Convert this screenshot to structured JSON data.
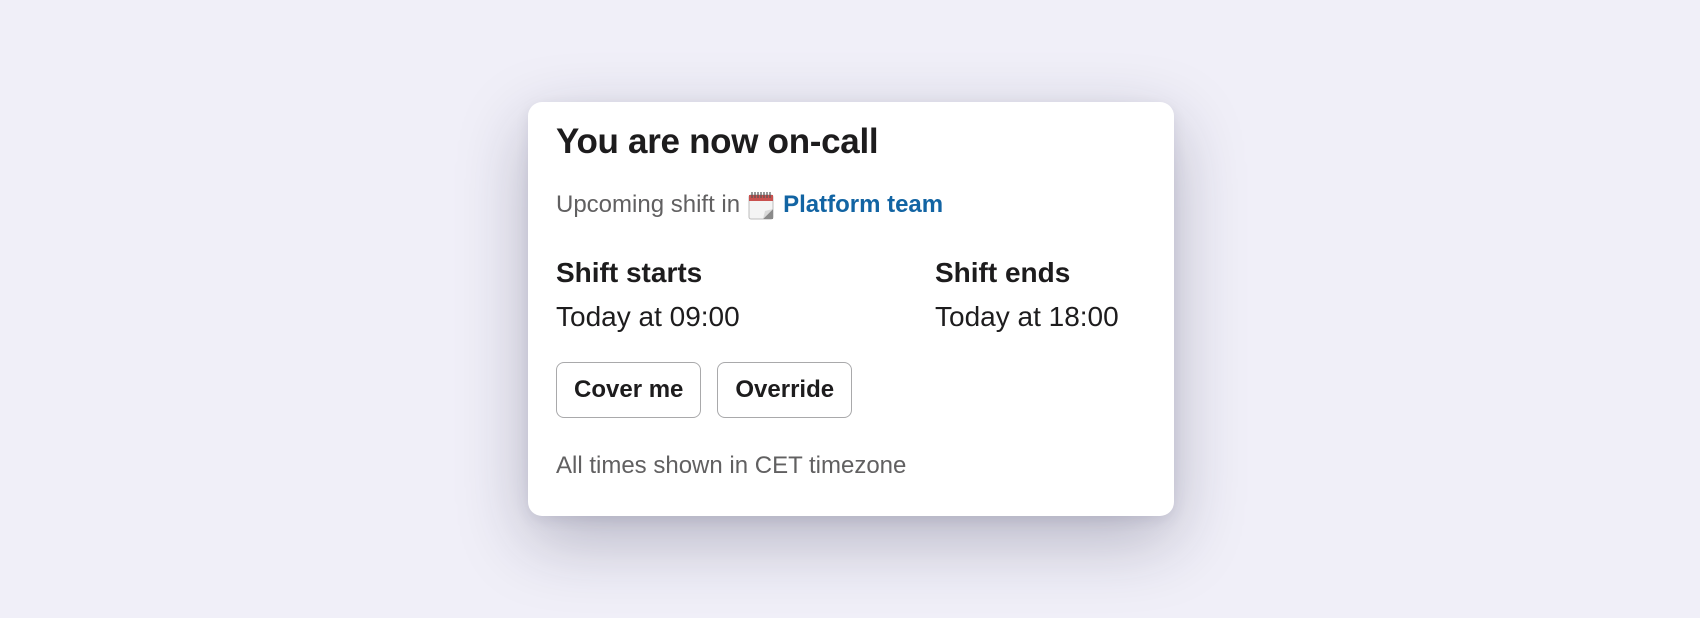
{
  "card": {
    "title": "You are now on-call",
    "subtitle_prefix": "Upcoming shift in",
    "calendar_icon": "spiral-calendar-icon",
    "team_name": "Platform team",
    "team_link_color": "#1264a3",
    "shift_start": {
      "label": "Shift starts",
      "value": "Today at 09:00"
    },
    "shift_end": {
      "label": "Shift ends",
      "value": "Today at 18:00"
    },
    "actions": [
      {
        "label": "Cover me"
      },
      {
        "label": "Override"
      }
    ],
    "footnote": "All times shown in CET timezone"
  }
}
